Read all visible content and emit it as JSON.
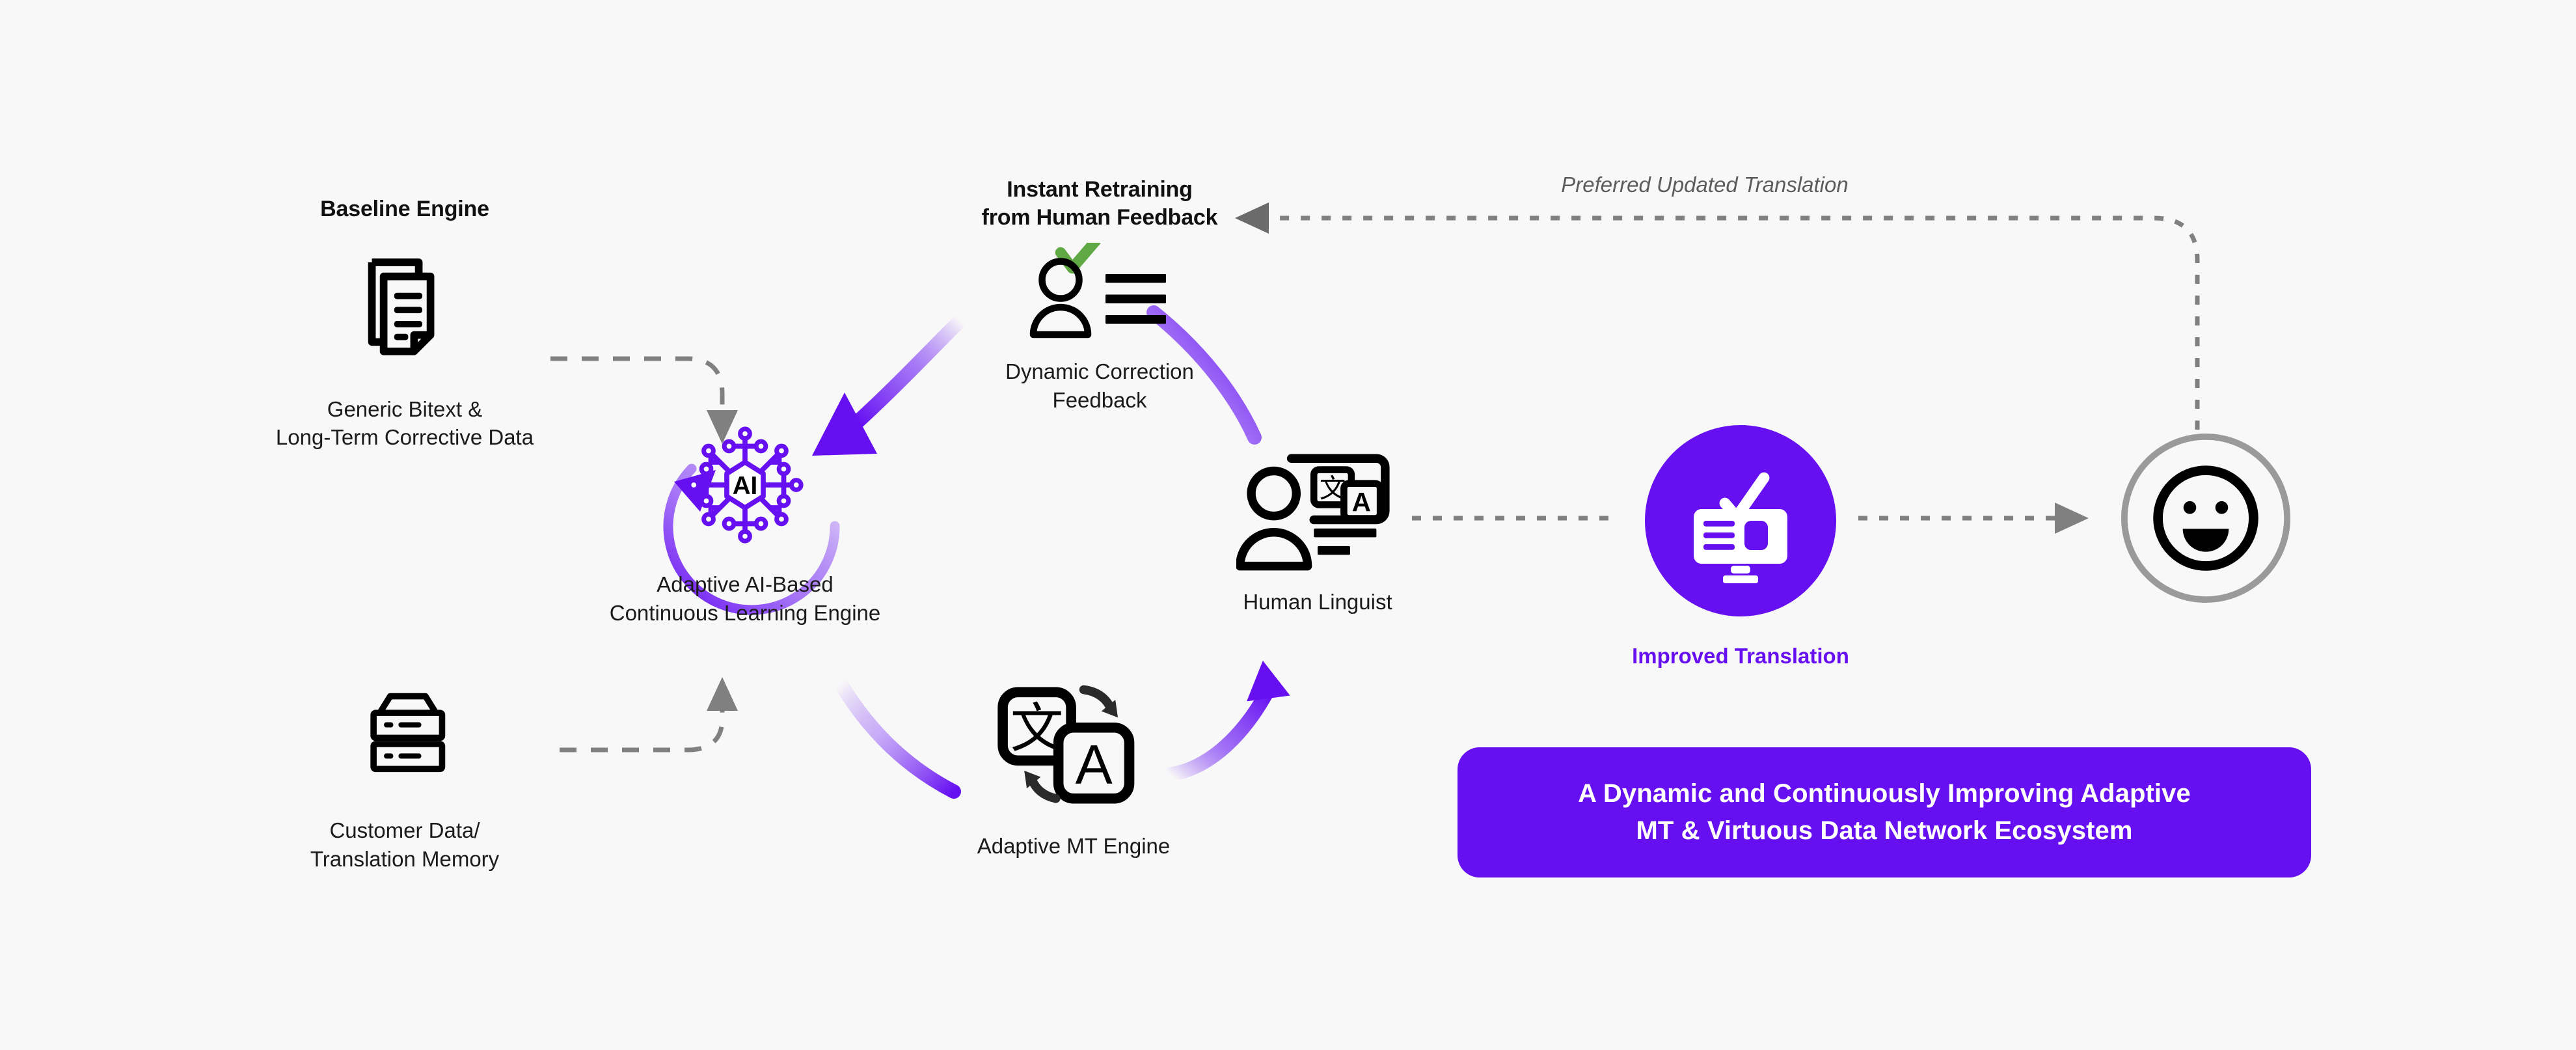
{
  "canvas": {
    "background": "#f8f8f8",
    "accent": "#6610f2",
    "accent_dark": "#5b0fd6",
    "line_gray": "#808080",
    "check_green": "#5fa844",
    "ink": "#111111"
  },
  "nodes": {
    "baseline": {
      "heading": "Baseline Engine",
      "icon": "documents-icon",
      "caption": "Generic Bitext &\nLong-Term Corrective Data"
    },
    "customer": {
      "heading": "",
      "icon": "database-server-icon",
      "caption": "Customer Data/\nTranslation Memory"
    },
    "ai_engine": {
      "heading": "",
      "icon": "ai-chip-icon",
      "icon_label": "AI",
      "caption": "Adaptive AI-Based\nContinuous Learning Engine"
    },
    "feedback": {
      "heading": "Instant Retraining\nfrom Human Feedback",
      "icon": "person-with-lines-check-icon",
      "caption": "Dynamic Correction\nFeedback"
    },
    "linguist": {
      "heading": "",
      "icon": "person-translate-screen-icon",
      "caption": "Human Linguist"
    },
    "mt_engine": {
      "heading": "",
      "icon": "translate-swap-icon",
      "glyph_source": "文",
      "glyph_target": "A",
      "caption": "Adaptive MT Engine"
    },
    "improved": {
      "heading": "",
      "icon": "monitor-check-icon",
      "caption": "Improved Translation"
    },
    "smiley": {
      "heading": "",
      "icon": "happy-face-icon",
      "caption": ""
    }
  },
  "edges": {
    "preferred_updated_translation": "Preferred Updated Translation"
  },
  "banner": {
    "text": "A Dynamic and Continuously Improving Adaptive\nMT & Virtuous Data Network Ecosystem"
  }
}
